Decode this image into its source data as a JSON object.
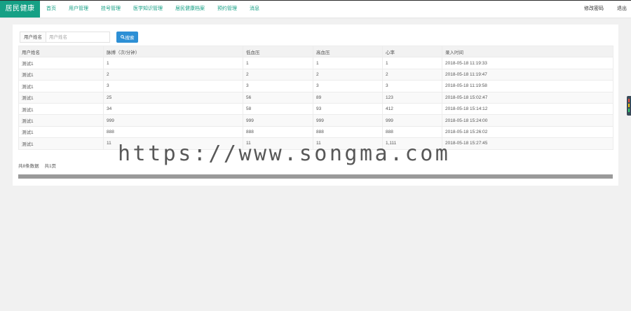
{
  "header": {
    "logo": "居民健康",
    "nav": [
      "首页",
      "用户管理",
      "挂号管理",
      "医学知识管理",
      "居民健康档案",
      "预约管理",
      "消息"
    ],
    "change_password": "修改密码",
    "logout": "退出"
  },
  "search": {
    "label": "用户姓名",
    "placeholder": "用户姓名",
    "button": "搜索"
  },
  "table": {
    "columns": [
      "用户姓名",
      "脉搏（次/分钟）",
      "低血压",
      "高血压",
      "心率",
      "录入时间"
    ],
    "rows": [
      [
        "测试1",
        "1",
        "1",
        "1",
        "1",
        "2018-05-18 11:19:33"
      ],
      [
        "测试1",
        "2",
        "2",
        "2",
        "2",
        "2018-05-18 11:19:47"
      ],
      [
        "测试1",
        "3",
        "3",
        "3",
        "3",
        "2018-05-18 11:19:58"
      ],
      [
        "测试1",
        "25",
        "56",
        "89",
        "123",
        "2018-05-18 15:02:47"
      ],
      [
        "测试1",
        "34",
        "58",
        "93",
        "412",
        "2018-05-18 15:14:12"
      ],
      [
        "测试1",
        "999",
        "999",
        "999",
        "999",
        "2018-05-18 15:24:00"
      ],
      [
        "测试1",
        "888",
        "888",
        "888",
        "888",
        "2018-05-18 15:26:02"
      ],
      [
        "测试1",
        "11",
        "11",
        "11",
        "1,111",
        "2018-05-18 15:27:45"
      ]
    ]
  },
  "pager": {
    "total_records": "共8条数据",
    "total_pages": "共1页"
  },
  "watermark": "https://www.songma.com",
  "colors": {
    "brand": "#16a085",
    "search_button": "#2d8fd5"
  }
}
